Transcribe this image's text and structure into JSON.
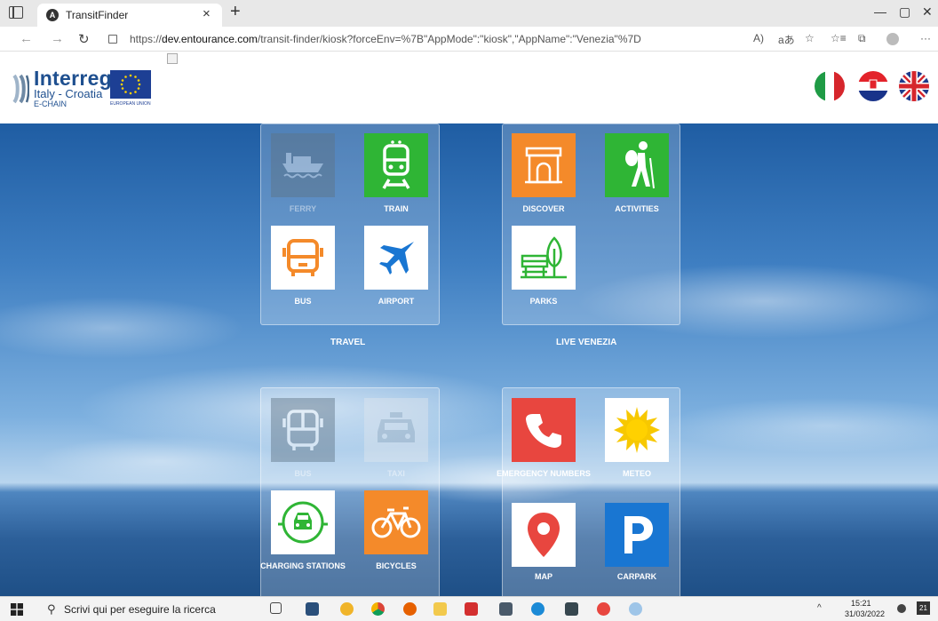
{
  "browser": {
    "tab_title": "TransitFinder",
    "tab_favicon_letter": "A",
    "url_prefix": "https://",
    "url_host": "dev.entourance.com",
    "url_path": "/transit-finder/kiosk?forceEnv=%7B\"AppMode\":\"kiosk\",\"AppName\":\"Venezia\"%7D",
    "toolbar_icons": [
      "read-aloud-icon",
      "translate-icon",
      "favorite-icon",
      "favorites-icon",
      "collections-icon",
      "profile-icon",
      "more-icon"
    ]
  },
  "header": {
    "logo_word": "Interreg",
    "logo_sub": "Italy - Croatia",
    "logo_project": "E-CHAIN",
    "eu_label": "EUROPEAN UNION",
    "languages": [
      "Italiano",
      "Hrvatski",
      "English"
    ]
  },
  "groups": [
    {
      "title": "TRAVEL",
      "tiles": [
        {
          "label": "FERRY",
          "icon": "ferry-icon",
          "bg": "#5e7385",
          "disabled": true
        },
        {
          "label": "TRAIN",
          "icon": "train-icon",
          "bg": "#2fb535",
          "disabled": false
        },
        {
          "label": "BUS",
          "icon": "bus-icon",
          "bg": "#ffffff",
          "disabled": false
        },
        {
          "label": "AIRPORT",
          "icon": "airport-icon",
          "bg": "#ffffff",
          "disabled": false
        }
      ]
    },
    {
      "title": "LIVE VENEZIA",
      "tiles": [
        {
          "label": "DISCOVER",
          "icon": "monument-icon",
          "bg": "#f48a2a",
          "disabled": false
        },
        {
          "label": "ACTIVITIES",
          "icon": "hiker-icon",
          "bg": "#2fb535",
          "disabled": false
        },
        {
          "label": "PARKS",
          "icon": "park-icon",
          "bg": "#ffffff",
          "disabled": false
        }
      ]
    },
    {
      "title": "",
      "tiles": [
        {
          "label": "BUS",
          "icon": "coach-icon",
          "bg": "#5e7385",
          "disabled": true
        },
        {
          "label": "TAXI",
          "icon": "taxi-icon",
          "bg": "#dfe6ee",
          "disabled": true
        },
        {
          "label": "CHARGING STATIONS",
          "icon": "ev-charging-icon",
          "bg": "#ffffff",
          "disabled": false
        },
        {
          "label": "BICYCLES",
          "icon": "bicycle-icon",
          "bg": "#f48a2a",
          "disabled": false
        }
      ]
    },
    {
      "title": "",
      "tiles": [
        {
          "label": "EMERGENCY NUMBERS",
          "icon": "phone-icon",
          "bg": "#e8463f",
          "disabled": false
        },
        {
          "label": "METEO",
          "icon": "sun-icon",
          "bg": "#ffffff",
          "disabled": false
        },
        {
          "label": "MAP",
          "icon": "map-pin-icon",
          "bg": "#ffffff",
          "disabled": false
        },
        {
          "label": "CARPARK",
          "icon": "parking-icon",
          "bg": "#1976d2",
          "disabled": false
        }
      ]
    }
  ],
  "taskbar": {
    "search_placeholder": "Scrivi qui per eseguire la ricerca",
    "time": "15:21",
    "date": "31/03/2022",
    "notification_count": "21",
    "apps": [
      "task-view-icon",
      "store-icon",
      "weather-icon",
      "chrome-icon",
      "firefox-icon",
      "file-explorer-icon",
      "pdf-icon",
      "docs-icon",
      "edge-icon",
      "calculator-icon",
      "app-icon",
      "paint-icon"
    ]
  },
  "colors": {
    "accent_blue": "#1e4f8f",
    "green": "#2fb535",
    "orange": "#f48a2a",
    "red": "#e8463f",
    "parking_blue": "#1976d2"
  }
}
